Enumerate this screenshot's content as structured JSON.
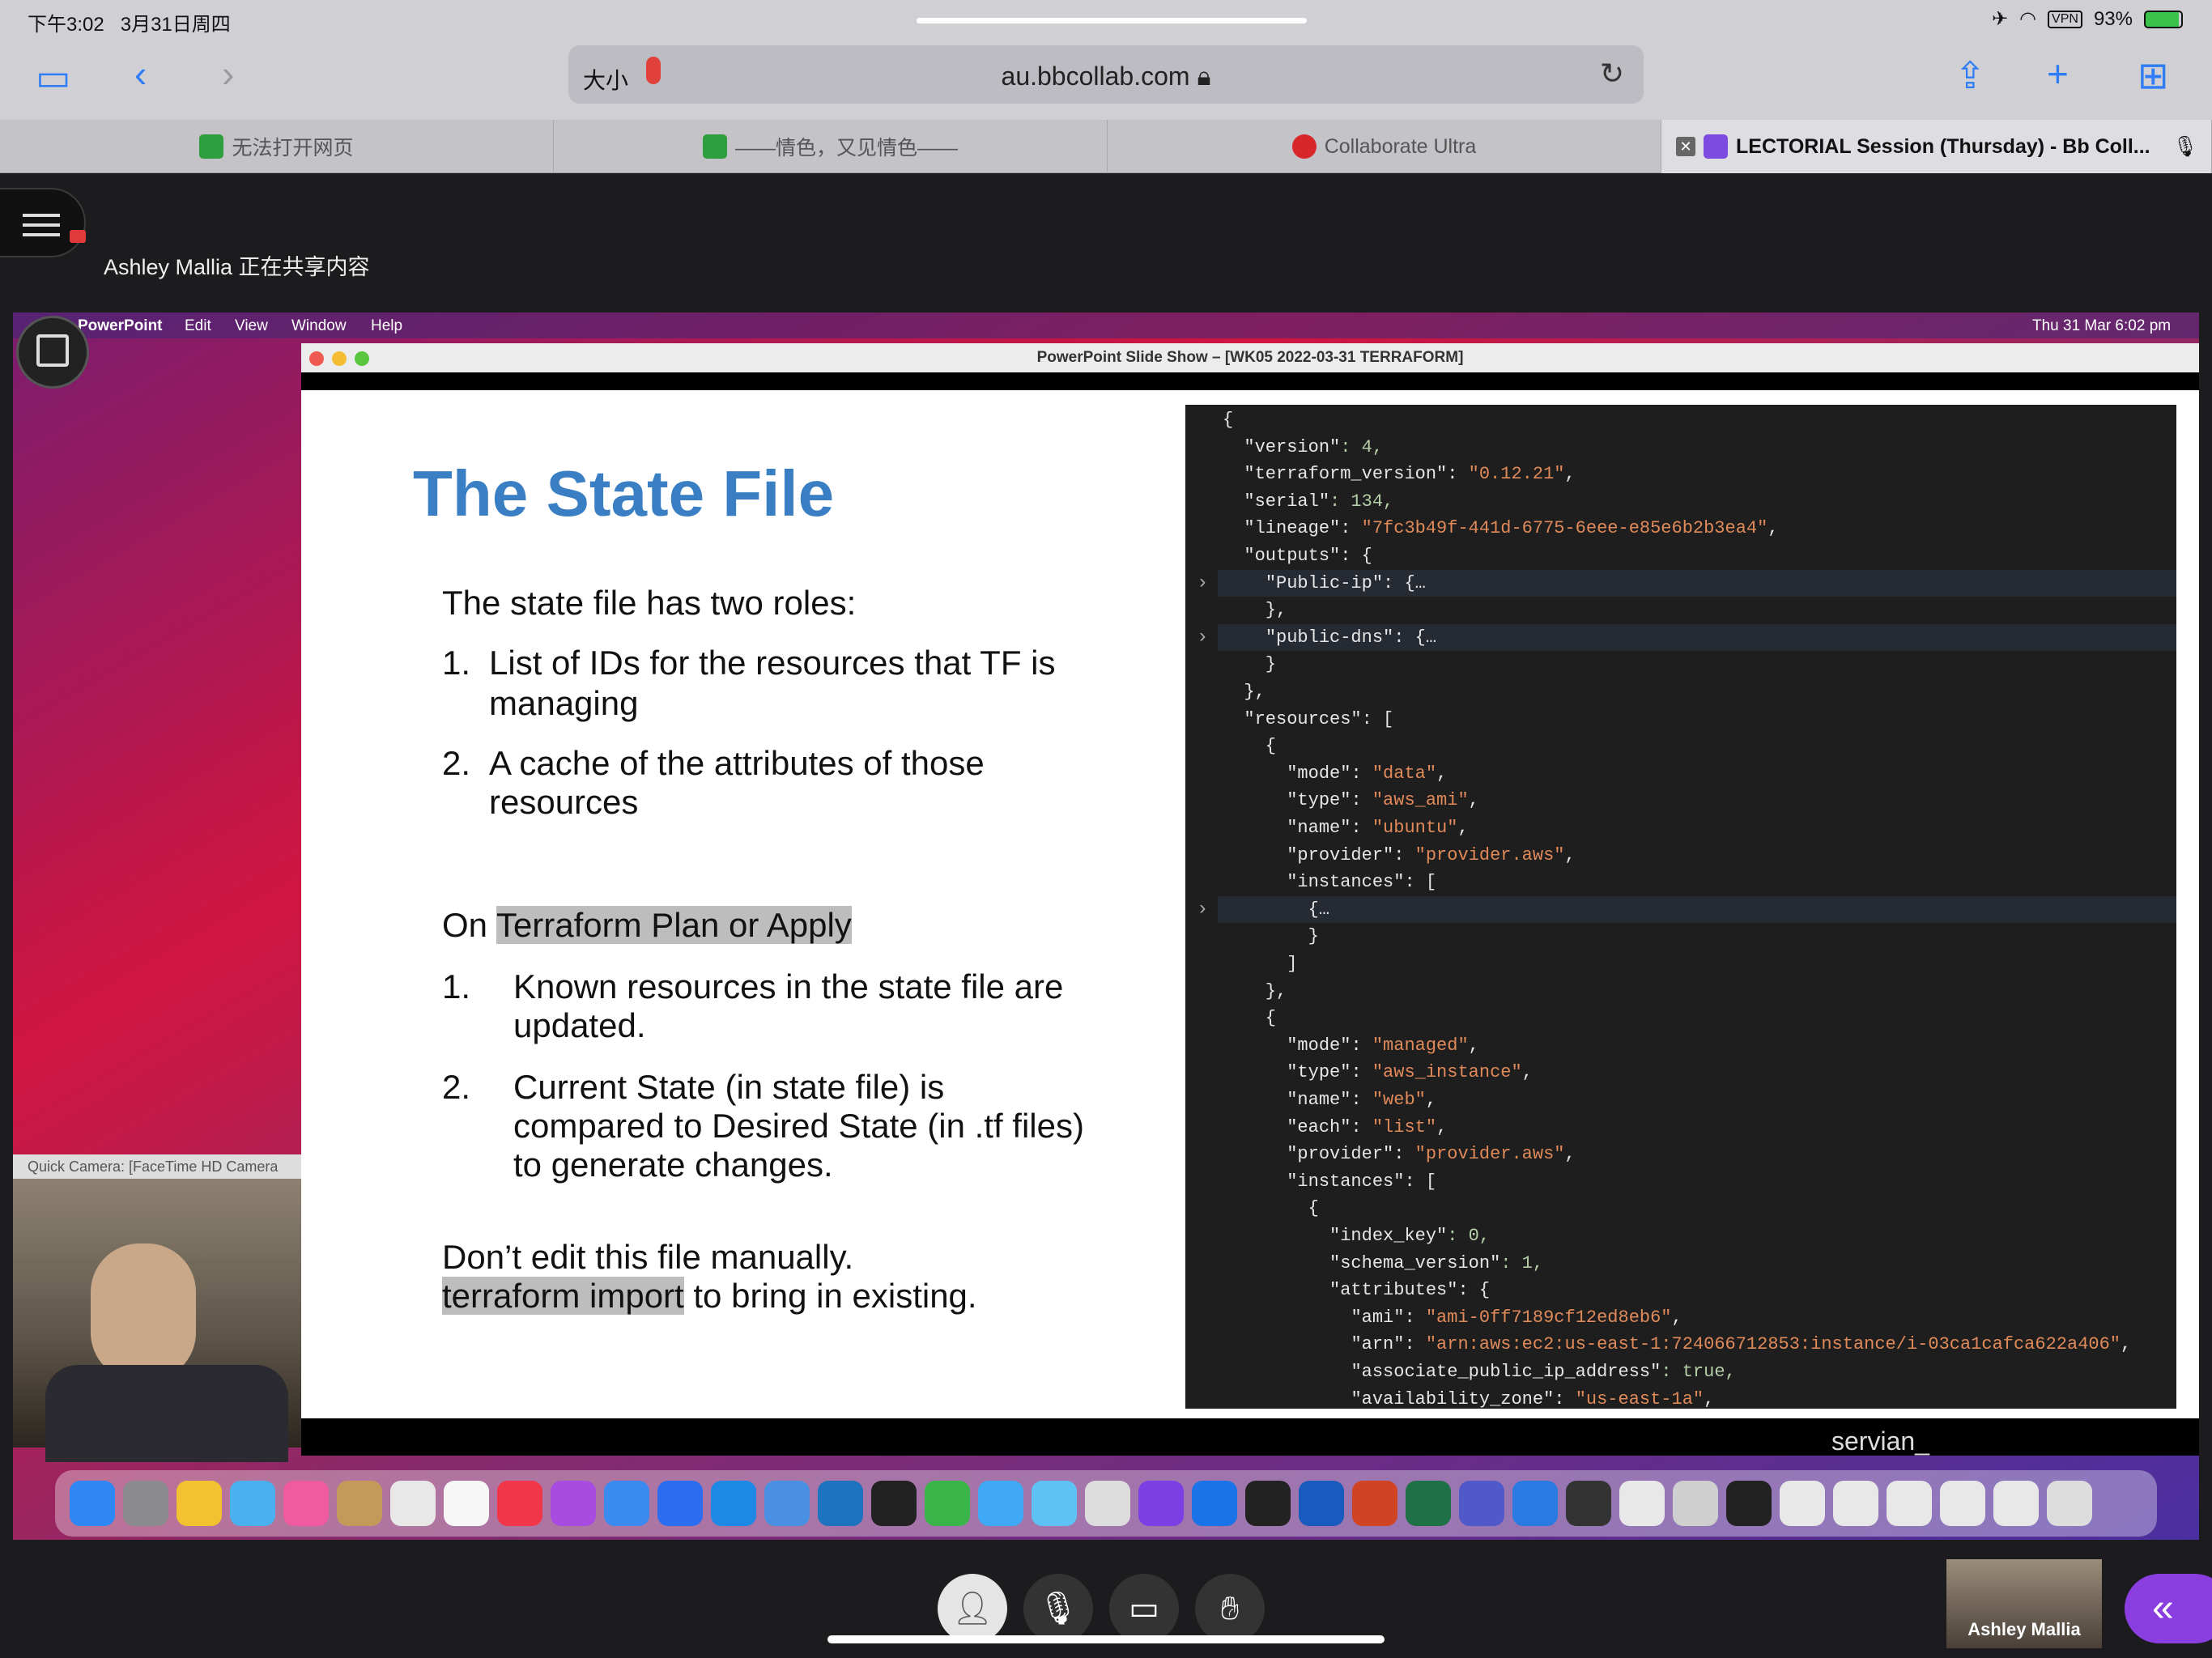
{
  "status": {
    "time": "下午3:02",
    "date": "3月31日周四",
    "vpn": "VPN",
    "battery": "93%"
  },
  "browser": {
    "text_size": "大小",
    "url": "au.bbcollab.com",
    "tabs": [
      {
        "label": "无法打开网页",
        "color": "#2e9e3e"
      },
      {
        "label": "——情色，又见情色——",
        "color": "#2e9e3e"
      },
      {
        "label": "Collaborate Ultra",
        "color": "#d9262a"
      },
      {
        "label": "LECTORIAL Session (Thursday) - Bb Coll...",
        "color": "#7d4be0"
      }
    ]
  },
  "session": {
    "sharing_text": "Ashley Mallia 正在共享内容"
  },
  "mac": {
    "menu": [
      "PowerPoint",
      "Edit",
      "View",
      "Window",
      "Help"
    ],
    "clock": "Thu 31 Mar  6:02 pm",
    "window_title": "PowerPoint Slide Show – [WK05 2022-03-31 TERRAFORM]",
    "camera_label": "Quick Camera: [FaceTime HD Camera"
  },
  "slide": {
    "title": "The State File",
    "lines": [
      "The state file has two roles:",
      "1.",
      "List of IDs for the resources that TF is",
      "managing",
      "2.",
      "A cache of the attributes of those",
      "resources",
      "On ",
      "Terraform Plan or Apply",
      "1.",
      "Known resources in the state file are",
      "updated.",
      "2.",
      "Current State (in state file) is",
      "compared to Desired State (in .tf files)",
      "to generate changes.",
      "Don’t edit this file manually.",
      "terraform import",
      " to bring in existing."
    ],
    "logo": "servian_"
  },
  "code": [
    "{",
    "  \"version\": 4,",
    "  \"terraform_version\": \"0.12.21\",",
    "  \"serial\": 134,",
    "  \"lineage\": \"7fc3b49f-441d-6775-6eee-e85e6b2b3ea4\",",
    "  \"outputs\": {",
    "    \"Public-ip\": {…",
    "    },",
    "    \"public-dns\": {…",
    "    }",
    "  },",
    "  \"resources\": [",
    "    {",
    "      \"mode\": \"data\",",
    "      \"type\": \"aws_ami\",",
    "      \"name\": \"ubuntu\",",
    "      \"provider\": \"provider.aws\",",
    "      \"instances\": [",
    "        {…",
    "        }",
    "      ]",
    "    },",
    "    {",
    "      \"mode\": \"managed\",",
    "      \"type\": \"aws_instance\",",
    "      \"name\": \"web\",",
    "      \"each\": \"list\",",
    "      \"provider\": \"provider.aws\",",
    "      \"instances\": [",
    "        {",
    "          \"index_key\": 0,",
    "          \"schema_version\": 1,",
    "          \"attributes\": {",
    "            \"ami\": \"ami-0ff7189cf12ed8eb6\",",
    "            \"arn\": \"arn:aws:ec2:us-east-1:724066712853:instance/i-03ca1cafca622a406\",",
    "            \"associate_public_ip_address\": true,",
    "            \"availability_zone\": \"us-east-1a\","
  ],
  "bottom": {
    "self_name": "Ashley Mallia"
  }
}
